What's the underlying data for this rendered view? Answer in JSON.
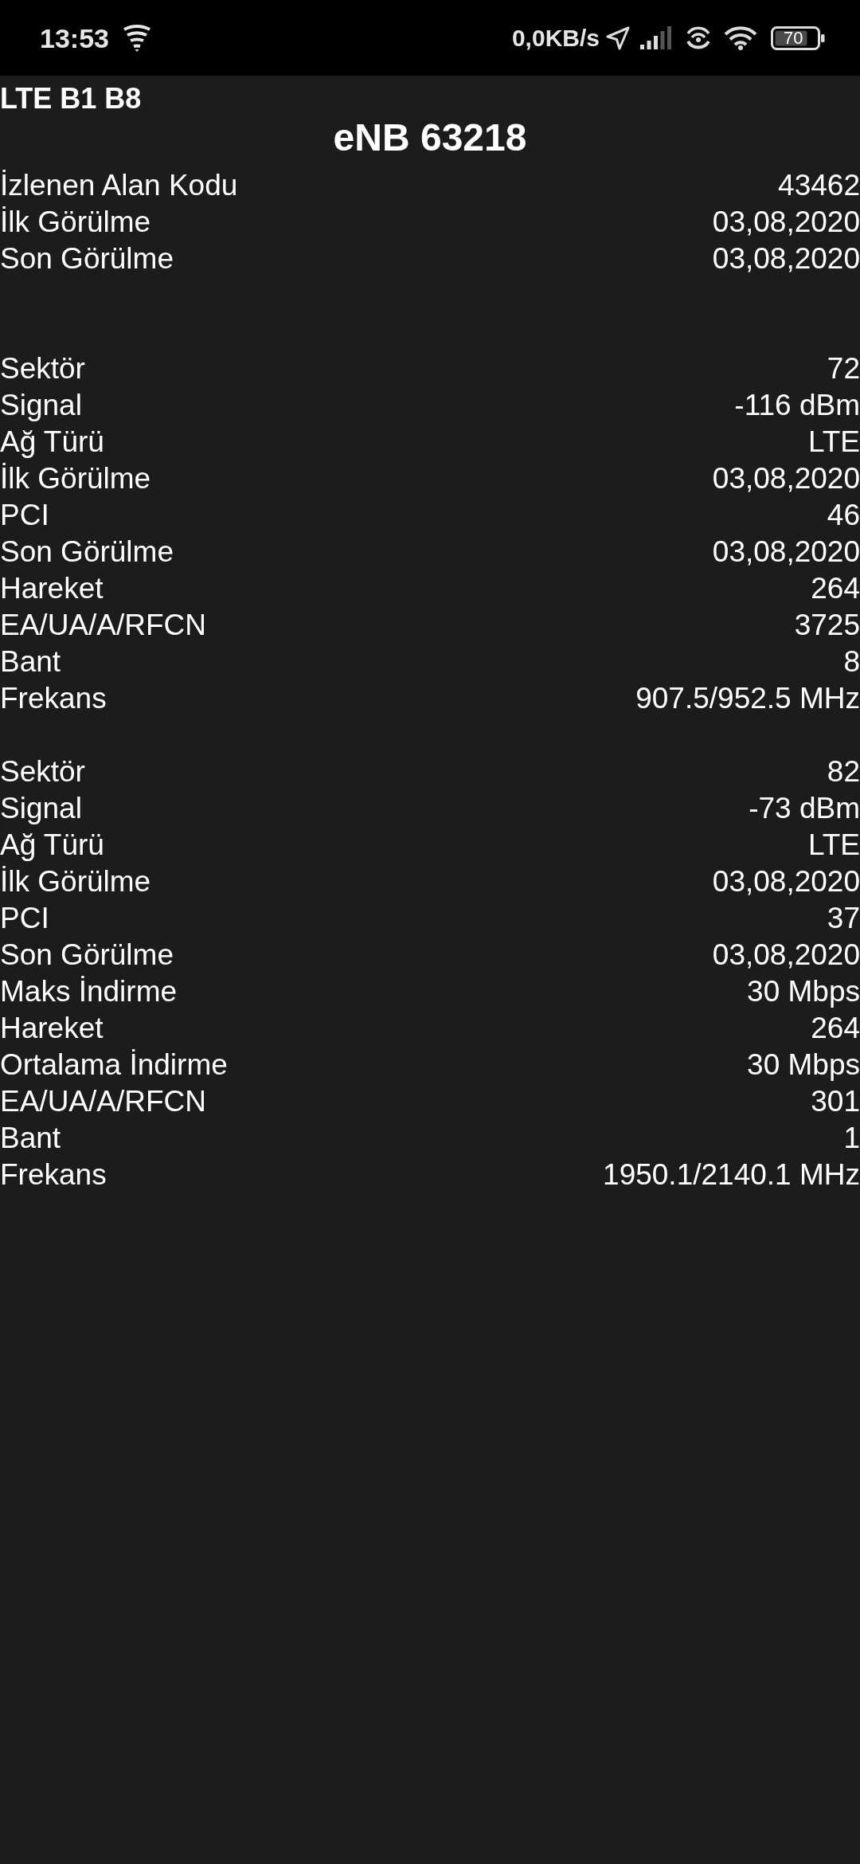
{
  "status_bar": {
    "time": "13:53",
    "network_speed": "0,0KB/s",
    "battery": "70"
  },
  "header": {
    "bands": "LTE B1 B8",
    "title": "eNB 63218"
  },
  "summary": [
    {
      "label": "İzlenen Alan Kodu",
      "value": "43462"
    },
    {
      "label": "İlk Görülme",
      "value": "03,08,2020"
    },
    {
      "label": "Son Görülme",
      "value": "03,08,2020"
    }
  ],
  "sectors": [
    {
      "rows": [
        {
          "label": "Sektör",
          "value": "72"
        },
        {
          "label": "Signal",
          "value": "-116 dBm"
        },
        {
          "label": "Ağ Türü",
          "value": "LTE"
        },
        {
          "label": "İlk Görülme",
          "value": "03,08,2020"
        },
        {
          "label": "PCI",
          "value": "46"
        },
        {
          "label": "Son Görülme",
          "value": "03,08,2020"
        },
        {
          "label": "Hareket",
          "value": "264"
        },
        {
          "label": "EA/UA/A/RFCN",
          "value": "3725"
        },
        {
          "label": "Bant",
          "value": "8"
        },
        {
          "label": "Frekans",
          "value": "907.5/952.5 MHz"
        }
      ]
    },
    {
      "rows": [
        {
          "label": "Sektör",
          "value": "82"
        },
        {
          "label": "Signal",
          "value": "-73 dBm"
        },
        {
          "label": "Ağ Türü",
          "value": "LTE"
        },
        {
          "label": "İlk Görülme",
          "value": "03,08,2020"
        },
        {
          "label": "PCI",
          "value": "37"
        },
        {
          "label": "Son Görülme",
          "value": "03,08,2020"
        },
        {
          "label": "Maks İndirme",
          "value": "30 Mbps"
        },
        {
          "label": "Hareket",
          "value": "264"
        },
        {
          "label": "Ortalama İndirme",
          "value": "30 Mbps"
        },
        {
          "label": "EA/UA/A/RFCN",
          "value": "301"
        },
        {
          "label": "Bant",
          "value": "1"
        },
        {
          "label": "Frekans",
          "value": "1950.1/2140.1 MHz"
        }
      ]
    }
  ]
}
